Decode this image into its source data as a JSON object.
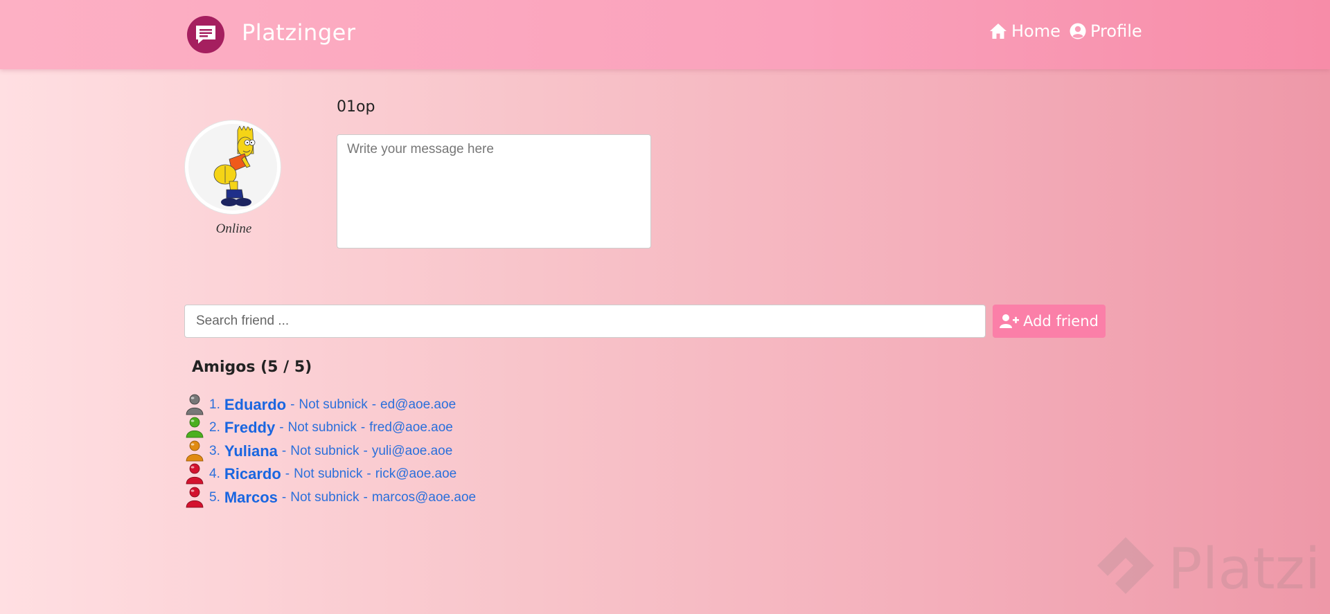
{
  "navbar": {
    "brand": "Platzinger",
    "home_label": "Home",
    "profile_label": "Profile"
  },
  "profile": {
    "nick": "01op",
    "status": "Online",
    "message_placeholder": "Write your message here"
  },
  "search": {
    "placeholder": "Search friend ...",
    "add_label": "Add friend"
  },
  "friends": {
    "title": "Amigos (5 / 5)",
    "items": [
      {
        "number": "1.",
        "name": "Eduardo",
        "subnick": "Not subnick",
        "email": "ed@aoe.aoe",
        "status_color": "#777777"
      },
      {
        "number": "2.",
        "name": "Freddy",
        "subnick": "Not subnick",
        "email": "fred@aoe.aoe",
        "status_color": "#4caf1f"
      },
      {
        "number": "3.",
        "name": "Yuliana",
        "subnick": "Not subnick",
        "email": "yuli@aoe.aoe",
        "status_color": "#e08a12"
      },
      {
        "number": "4.",
        "name": "Ricardo",
        "subnick": "Not subnick",
        "email": "rick@aoe.aoe",
        "status_color": "#d3122e"
      },
      {
        "number": "5.",
        "name": "Marcos",
        "subnick": "Not subnick",
        "email": "marcos@aoe.aoe",
        "status_color": "#d3122e"
      }
    ]
  },
  "watermark": {
    "text": "Platzi"
  },
  "icons": {
    "brand": "chat-bubble-icon",
    "home": "home-icon",
    "profile": "user-circle-icon",
    "add": "user-plus-icon",
    "friend": "messenger-person-icon"
  },
  "colors": {
    "navbar": "#faa2bc",
    "brand_logo": "#a51f5f",
    "add_button": "#fb7fa8",
    "link": "#1a66e0"
  }
}
